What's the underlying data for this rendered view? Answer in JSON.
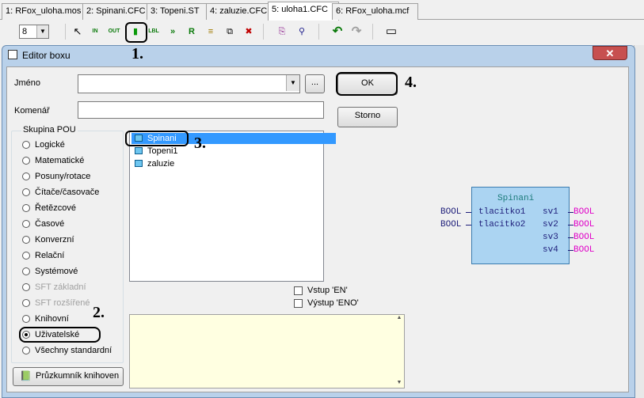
{
  "tabs": [
    {
      "label": "1: RFox_uloha.mos"
    },
    {
      "label": "2: Spinani.CFC"
    },
    {
      "label": "3: Topeni.ST"
    },
    {
      "label": "4: zaluzie.CFC"
    },
    {
      "label": "5: uloha1.CFC"
    },
    {
      "label": "6: RFox_uloha.mcf"
    }
  ],
  "toolbar": {
    "zoom_value": "8",
    "tools": [
      {
        "icon": "cursor-icon",
        "glyph": "↖"
      },
      {
        "icon": "input-icon",
        "glyph": "IN"
      },
      {
        "icon": "output-icon",
        "glyph": "OUT"
      },
      {
        "icon": "box-icon",
        "glyph": "▮"
      },
      {
        "icon": "label-icon",
        "glyph": "LBL"
      },
      {
        "icon": "jump-icon",
        "glyph": "»"
      },
      {
        "icon": "return-icon",
        "glyph": "R"
      },
      {
        "icon": "comment-icon",
        "glyph": "≡"
      },
      {
        "icon": "macro-icon",
        "glyph": "⧉"
      },
      {
        "icon": "delete-icon",
        "glyph": "✖"
      },
      {
        "icon": "copy-icon",
        "glyph": "⎘"
      },
      {
        "icon": "find-icon",
        "glyph": "⚲"
      },
      {
        "icon": "undo-icon",
        "glyph": "↶"
      },
      {
        "icon": "redo-icon",
        "glyph": "↷"
      },
      {
        "icon": "window-icon",
        "glyph": "▭"
      }
    ]
  },
  "annotations": {
    "a1": "1.",
    "a2": "2.",
    "a3": "3.",
    "a4": "4."
  },
  "dialog": {
    "title": "Editor boxu",
    "close_glyph": "✕",
    "name_label": "Jméno",
    "name_value": "",
    "browse_label": "...",
    "comment_label": "Komenář",
    "comment_value": "",
    "ok_label": "OK",
    "cancel_label": "Storno",
    "group_label": "Skupina POU",
    "groups": [
      {
        "label": "Logické",
        "enabled": true,
        "checked": false
      },
      {
        "label": "Matematické",
        "enabled": true,
        "checked": false
      },
      {
        "label": "Posuny/rotace",
        "enabled": true,
        "checked": false
      },
      {
        "label": "Čítače/časovače",
        "enabled": true,
        "checked": false
      },
      {
        "label": "Řetězcové",
        "enabled": true,
        "checked": false
      },
      {
        "label": "Časové",
        "enabled": true,
        "checked": false
      },
      {
        "label": "Konverzní",
        "enabled": true,
        "checked": false
      },
      {
        "label": "Relační",
        "enabled": true,
        "checked": false
      },
      {
        "label": "Systémové",
        "enabled": true,
        "checked": false
      },
      {
        "label": "SFT základní",
        "enabled": false,
        "checked": false
      },
      {
        "label": "SFT rozšířené",
        "enabled": false,
        "checked": false
      },
      {
        "label": "Knihovní",
        "enabled": true,
        "checked": false
      },
      {
        "label": "Uživatelské",
        "enabled": true,
        "checked": true
      },
      {
        "label": "Všechny standardní",
        "enabled": true,
        "checked": false
      }
    ],
    "pou_list": [
      {
        "label": "Spinani",
        "selected": true
      },
      {
        "label": "Topeni1",
        "selected": false
      },
      {
        "label": "zaluzie",
        "selected": false
      }
    ],
    "en_label": "Vstup 'EN'",
    "eno_label": "Výstup 'ENO'",
    "library_button": "Průzkumník knihoven"
  },
  "preview": {
    "block_name": "Spinani",
    "inputs": [
      {
        "type": "BOOL",
        "name": "tlacitko1"
      },
      {
        "type": "BOOL",
        "name": "tlacitko2"
      }
    ],
    "outputs": [
      {
        "type": "BOOL",
        "name": "sv1"
      },
      {
        "type": "BOOL",
        "name": "sv2"
      },
      {
        "type": "BOOL",
        "name": "sv3"
      },
      {
        "type": "BOOL",
        "name": "sv4"
      }
    ]
  },
  "colors": {
    "selection": "#3399ff",
    "block_fill": "#abd4f2",
    "input_type": "#1d1d7a",
    "output_type": "#e000c8",
    "block_title": "#1a7a7a"
  }
}
